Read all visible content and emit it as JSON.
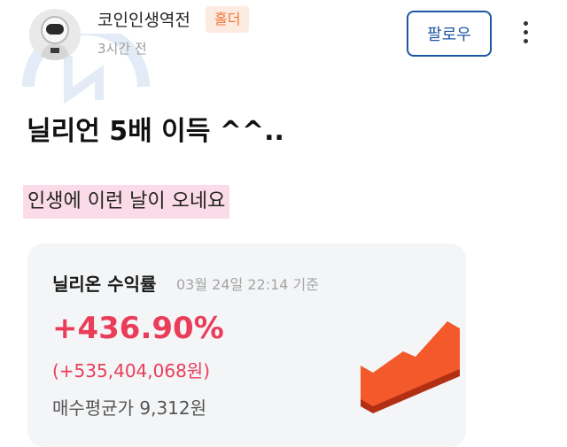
{
  "post": {
    "author": "코인인생역전",
    "badge": "홀더",
    "time": "3시간 전",
    "follow_label": "팔로우",
    "title": "닐리언 5배 이득 ^^..",
    "body": "인생에 이런 날이 오네요"
  },
  "card": {
    "title": "닐리온 수익률",
    "timestamp": "03월 24일 22:14 기준",
    "return_pct": "+436.90%",
    "profit": "(+535,404,068원)",
    "avg_price": "매수평균가 9,312원"
  },
  "icons": {
    "more": "more-vertical-icon",
    "chart": "rising-chart-icon"
  },
  "colors": {
    "accent": "#1d56a4",
    "badge_text": "#f2743a",
    "badge_bg": "#fdebe1",
    "profit": "#ea3d59",
    "highlight": "#fbdbe7",
    "card_bg": "#f4f5f7"
  }
}
